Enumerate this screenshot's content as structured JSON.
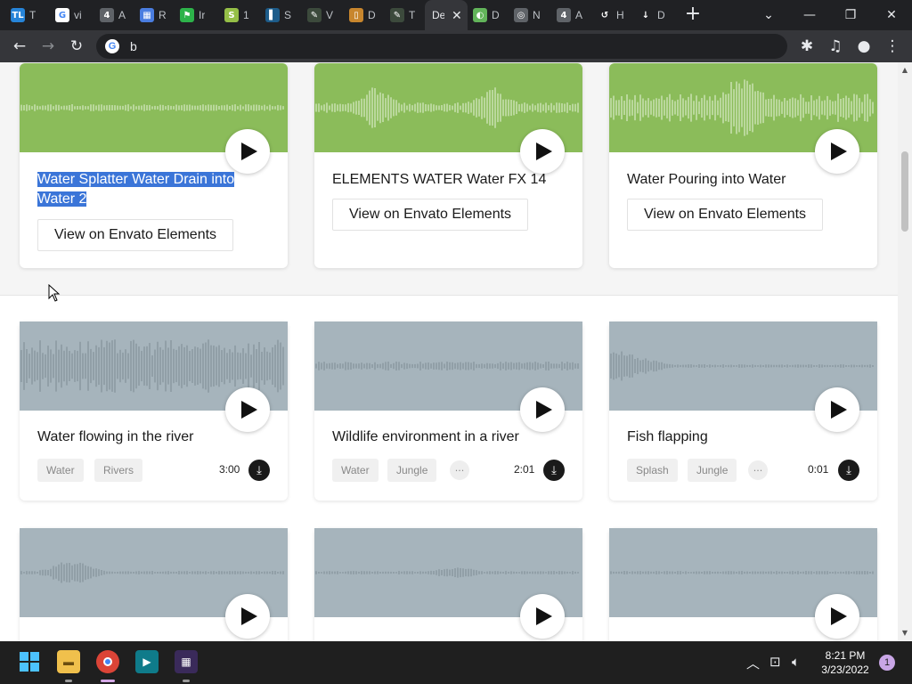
{
  "browser": {
    "tabs": [
      {
        "icon": "trello-icon",
        "fav_text": "TL",
        "fav_color": "#2684d8",
        "title": "T"
      },
      {
        "icon": "google-icon",
        "fav_text": "G",
        "fav_color": "#ffffff",
        "title": "vi"
      },
      {
        "icon": "badge-4-icon",
        "fav_text": "4",
        "fav_color": "#5f6368",
        "title": "A"
      },
      {
        "icon": "grid-app-icon",
        "fav_text": "▦",
        "fav_color": "#4a7de0",
        "title": "R"
      },
      {
        "icon": "flag-icon",
        "fav_text": "⚑",
        "fav_color": "#2db34a",
        "title": "Ir"
      },
      {
        "icon": "shopify-icon",
        "fav_text": "S",
        "fav_color": "#95bf47",
        "title": "1"
      },
      {
        "icon": "dark-square-icon",
        "fav_text": "▌",
        "fav_color": "#1d5c8a",
        "title": "S"
      },
      {
        "icon": "feather-icon",
        "fav_text": "✎",
        "fav_color": "#3c4a3c",
        "title": "V"
      },
      {
        "icon": "bookmark-icon",
        "fav_text": "▯",
        "fav_color": "#c8862d",
        "title": "D"
      },
      {
        "icon": "feather-icon",
        "fav_text": "✎",
        "fav_color": "#3c4a3c",
        "title": "T"
      },
      {
        "icon": "active-tab",
        "fav_text": "",
        "fav_color": "#35363a",
        "title": "De"
      },
      {
        "icon": "leaf-icon",
        "fav_text": "◐",
        "fav_color": "#62b45a",
        "title": "D"
      },
      {
        "icon": "chrome-icon",
        "fav_text": "◎",
        "fav_color": "#5f6368",
        "title": "N"
      },
      {
        "icon": "badge-4-icon",
        "fav_text": "4",
        "fav_color": "#5f6368",
        "title": "A"
      },
      {
        "icon": "history-icon",
        "fav_text": "↺",
        "fav_color": "#202124",
        "title": "H"
      },
      {
        "icon": "download-icon",
        "fav_text": "↓",
        "fav_color": "#202124",
        "title": "D"
      }
    ],
    "address": "b"
  },
  "top_cards": [
    {
      "title_line1": "Water Splatter Water Drain into",
      "title_line2": "Water 2",
      "button": "View on Envato Elements"
    },
    {
      "title_line1": "ELEMENTS WATER Water FX 14",
      "title_line2": "",
      "button": "View on Envato Elements"
    },
    {
      "title_line1": "Water Pouring into Water",
      "title_line2": "",
      "button": "View on Envato Elements"
    }
  ],
  "sound_cards": [
    {
      "title": "Water flowing in the river",
      "tags": [
        "Water",
        "Rivers"
      ],
      "more": false,
      "duration": "3:00"
    },
    {
      "title": "Wildlife environment in a river",
      "tags": [
        "Water",
        "Jungle"
      ],
      "more": true,
      "duration": "2:01"
    },
    {
      "title": "Fish flapping",
      "tags": [
        "Splash",
        "Jungle"
      ],
      "more": true,
      "duration": "0:01"
    }
  ],
  "taskbar": {
    "time": "8:21 PM",
    "date": "3/23/2022",
    "notifications": "1"
  },
  "colors": {
    "green_wave": "#8bbc5a",
    "grey_wave": "#a6b4bc",
    "selection": "#3b75d8"
  }
}
